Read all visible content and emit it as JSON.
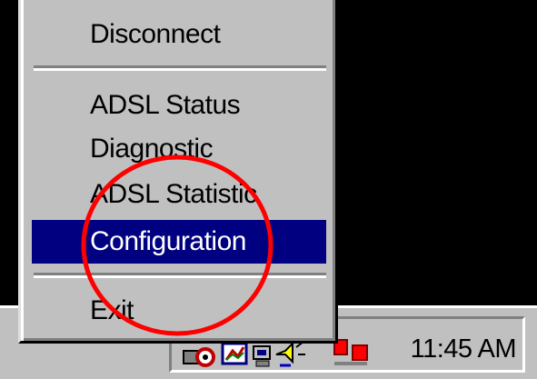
{
  "menu": {
    "items": [
      {
        "label": "Disconnect"
      },
      {
        "label": "ADSL Status"
      },
      {
        "label": "Diagnostic"
      },
      {
        "label": "ADSL Statistic"
      },
      {
        "label": "Configuration"
      },
      {
        "label": "Exit"
      }
    ],
    "selected_index": 4,
    "selected_color": "#000080"
  },
  "tray": {
    "clock": "11:45 AM",
    "icons": [
      "modem-icon",
      "network-icon",
      "volume-icon",
      "connection-icon"
    ]
  },
  "colors": {
    "face": "#c0c0c0",
    "highlight": "#000080",
    "annotation": "#ff0000"
  }
}
